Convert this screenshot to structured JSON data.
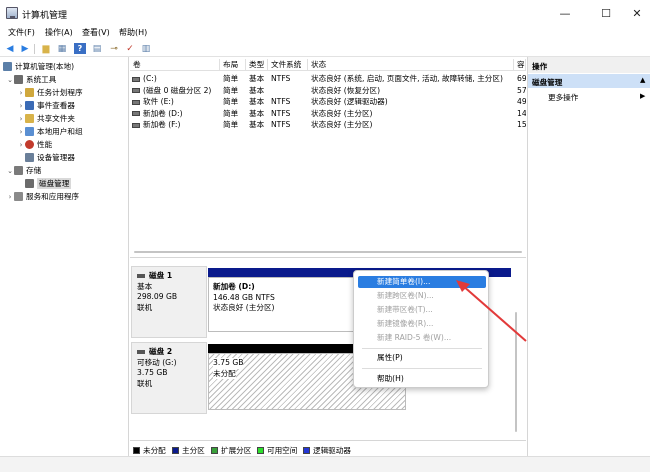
{
  "window": {
    "title": "计算机管理",
    "minimize": "—",
    "maximize": "☐",
    "close": "✕"
  },
  "menu": [
    "文件(F)",
    "操作(A)",
    "查看(V)",
    "帮助(H)"
  ],
  "toolbar_icons": [
    "back-arrow-icon",
    "forward-arrow-icon",
    "up-folder-icon",
    "show-hide-tree-icon",
    "help-icon",
    "properties-icon",
    "key-icon",
    "check-icon",
    "export-list-icon"
  ],
  "tree": [
    {
      "label": "计算机管理(本地)",
      "level": 0,
      "arrow": "",
      "icon": "computer-mgmt-icon",
      "color": "#5b7fa8"
    },
    {
      "label": "系统工具",
      "level": 1,
      "arrow": "v",
      "icon": "system-tools-icon",
      "color": "#6c6c6c"
    },
    {
      "label": "任务计划程序",
      "level": 2,
      "arrow": ">",
      "icon": "task-scheduler-icon",
      "color": "#d0a83d"
    },
    {
      "label": "事件查看器",
      "level": 2,
      "arrow": ">",
      "icon": "event-viewer-icon",
      "color": "#3b6bb5"
    },
    {
      "label": "共享文件夹",
      "level": 2,
      "arrow": ">",
      "icon": "shared-folder-icon",
      "color": "#d8b34a"
    },
    {
      "label": "本地用户和组",
      "level": 2,
      "arrow": ">",
      "icon": "users-icon",
      "color": "#5a8fd2"
    },
    {
      "label": "性能",
      "level": 2,
      "arrow": ">",
      "icon": "performance-icon",
      "color": "#c23b2c"
    },
    {
      "label": "设备管理器",
      "level": 2,
      "arrow": "",
      "icon": "device-manager-icon",
      "color": "#6a7f99"
    },
    {
      "label": "存储",
      "level": 1,
      "arrow": "v",
      "icon": "storage-icon",
      "color": "#7a7a7a"
    },
    {
      "label": "磁盘管理",
      "level": 2,
      "arrow": "",
      "icon": "disk-management-icon",
      "color": "#6b6b6b",
      "selected": true
    },
    {
      "label": "服务和应用程序",
      "level": 1,
      "arrow": ">",
      "icon": "services-icon",
      "color": "#8a8a8a"
    }
  ],
  "volume_table": {
    "headers": [
      "卷",
      "布局",
      "类型",
      "文件系统",
      "状态",
      "容"
    ],
    "rows": [
      {
        "name": "(C:)",
        "layout": "简单",
        "type": "基本",
        "fs": "NTFS",
        "status": "状态良好 (系统, 启动, 页面文件, 活动, 故障转储, 主分区)",
        "cap": "69"
      },
      {
        "name": "(磁盘 0 磁盘分区 2)",
        "layout": "简单",
        "type": "基本",
        "fs": "",
        "status": "状态良好 (恢复分区)",
        "cap": "57"
      },
      {
        "name": "软件 (E:)",
        "layout": "简单",
        "type": "基本",
        "fs": "NTFS",
        "status": "状态良好 (逻辑驱动器)",
        "cap": "49"
      },
      {
        "name": "新加卷 (D:)",
        "layout": "简单",
        "type": "基本",
        "fs": "NTFS",
        "status": "状态良好 (主分区)",
        "cap": "14"
      },
      {
        "name": "新加卷 (F:)",
        "layout": "简单",
        "type": "基本",
        "fs": "NTFS",
        "status": "状态良好 (主分区)",
        "cap": "15"
      }
    ]
  },
  "disks": [
    {
      "label": "磁盘 1",
      "kind": "基本",
      "size": "298.09 GB",
      "state": "联机",
      "part_name": "新加卷 (D:)",
      "part_size": "146.48 GB NTFS",
      "part_status": "状态良好 (主分区)"
    },
    {
      "label": "磁盘 2",
      "kind": "可移动 (G:)",
      "size": "3.75 GB",
      "state": "联机",
      "part_name": "",
      "part_size": "3.75 GB",
      "part_status": "未分配"
    }
  ],
  "legend": [
    {
      "label": "未分配",
      "color": "#000000"
    },
    {
      "label": "主分区",
      "color": "#0a1a8c"
    },
    {
      "label": "扩展分区",
      "color": "#39a03a"
    },
    {
      "label": "可用空间",
      "color": "#2ee02e"
    },
    {
      "label": "逻辑驱动器",
      "color": "#2436d6"
    }
  ],
  "actions": {
    "title": "操作",
    "section": "磁盘管理",
    "more": "更多操作"
  },
  "context_menu": [
    {
      "label": "新建简单卷(I)...",
      "enabled": true,
      "highlight": true
    },
    {
      "label": "新建跨区卷(N)...",
      "enabled": false
    },
    {
      "label": "新建带区卷(T)...",
      "enabled": false
    },
    {
      "label": "新建镜像卷(R)...",
      "enabled": false
    },
    {
      "label": "新建 RAID-5 卷(W)...",
      "enabled": false
    },
    {
      "sep": true
    },
    {
      "label": "属性(P)",
      "enabled": true
    },
    {
      "sep": true
    },
    {
      "label": "帮助(H)",
      "enabled": true
    }
  ],
  "colors": {
    "accent": "#2a7de1",
    "primary_partition": "#0a1a8c",
    "unallocated": "#000000",
    "arrow": "#e23a3a"
  }
}
